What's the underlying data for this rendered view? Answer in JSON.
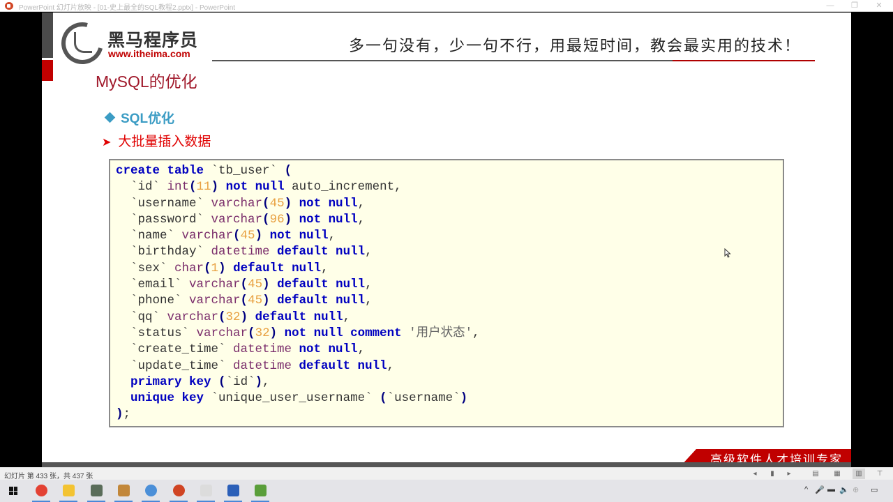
{
  "window": {
    "title": "PowerPoint 幻灯片放映 - [01-史上最全的SQL教程2.pptx] - PowerPoint",
    "minimize_label": "—",
    "restore_label": "❐",
    "close_label": "✕"
  },
  "slide": {
    "logo": {
      "brand_cn": "黑马程序员",
      "brand_url": "www.itheima.com"
    },
    "slogan": "多一句没有，少一句不行，用最短时间，教会最实用的技术！",
    "title": "MySQL的优化",
    "bullet_level1": "SQL优化",
    "bullet_level2": "大批量插入数据",
    "code_lines": [
      [
        {
          "t": "create table",
          "c": "kw"
        },
        {
          "t": " `tb_user` ",
          "c": ""
        },
        {
          "t": "(",
          "c": "pn"
        }
      ],
      [
        {
          "t": "  `id` ",
          "c": ""
        },
        {
          "t": "int",
          "c": "ty"
        },
        {
          "t": "(",
          "c": "pn"
        },
        {
          "t": "11",
          "c": "num"
        },
        {
          "t": ")",
          "c": "pn"
        },
        {
          "t": " not null",
          "c": "kw"
        },
        {
          "t": " auto_increment,",
          "c": ""
        }
      ],
      [
        {
          "t": "  `username` ",
          "c": ""
        },
        {
          "t": "varchar",
          "c": "ty"
        },
        {
          "t": "(",
          "c": "pn"
        },
        {
          "t": "45",
          "c": "num"
        },
        {
          "t": ")",
          "c": "pn"
        },
        {
          "t": " not null",
          "c": "kw"
        },
        {
          "t": ",",
          "c": ""
        }
      ],
      [
        {
          "t": "  `password` ",
          "c": ""
        },
        {
          "t": "varchar",
          "c": "ty"
        },
        {
          "t": "(",
          "c": "pn"
        },
        {
          "t": "96",
          "c": "num"
        },
        {
          "t": ")",
          "c": "pn"
        },
        {
          "t": " not null",
          "c": "kw"
        },
        {
          "t": ",",
          "c": ""
        }
      ],
      [
        {
          "t": "  `name` ",
          "c": ""
        },
        {
          "t": "varchar",
          "c": "ty"
        },
        {
          "t": "(",
          "c": "pn"
        },
        {
          "t": "45",
          "c": "num"
        },
        {
          "t": ")",
          "c": "pn"
        },
        {
          "t": " not null",
          "c": "kw"
        },
        {
          "t": ",",
          "c": ""
        }
      ],
      [
        {
          "t": "  `birthday` ",
          "c": ""
        },
        {
          "t": "datetime",
          "c": "ty"
        },
        {
          "t": " default null",
          "c": "kw"
        },
        {
          "t": ",",
          "c": ""
        }
      ],
      [
        {
          "t": "  `sex` ",
          "c": ""
        },
        {
          "t": "char",
          "c": "ty"
        },
        {
          "t": "(",
          "c": "pn"
        },
        {
          "t": "1",
          "c": "num"
        },
        {
          "t": ")",
          "c": "pn"
        },
        {
          "t": " default null",
          "c": "kw"
        },
        {
          "t": ",",
          "c": ""
        }
      ],
      [
        {
          "t": "  `email` ",
          "c": ""
        },
        {
          "t": "varchar",
          "c": "ty"
        },
        {
          "t": "(",
          "c": "pn"
        },
        {
          "t": "45",
          "c": "num"
        },
        {
          "t": ")",
          "c": "pn"
        },
        {
          "t": " default null",
          "c": "kw"
        },
        {
          "t": ",",
          "c": ""
        }
      ],
      [
        {
          "t": "  `phone` ",
          "c": ""
        },
        {
          "t": "varchar",
          "c": "ty"
        },
        {
          "t": "(",
          "c": "pn"
        },
        {
          "t": "45",
          "c": "num"
        },
        {
          "t": ")",
          "c": "pn"
        },
        {
          "t": " default null",
          "c": "kw"
        },
        {
          "t": ",",
          "c": ""
        }
      ],
      [
        {
          "t": "  `qq` ",
          "c": ""
        },
        {
          "t": "varchar",
          "c": "ty"
        },
        {
          "t": "(",
          "c": "pn"
        },
        {
          "t": "32",
          "c": "num"
        },
        {
          "t": ")",
          "c": "pn"
        },
        {
          "t": " default null",
          "c": "kw"
        },
        {
          "t": ",",
          "c": ""
        }
      ],
      [
        {
          "t": "  `status` ",
          "c": ""
        },
        {
          "t": "varchar",
          "c": "ty"
        },
        {
          "t": "(",
          "c": "pn"
        },
        {
          "t": "32",
          "c": "num"
        },
        {
          "t": ")",
          "c": "pn"
        },
        {
          "t": " not null comment",
          "c": "kw"
        },
        {
          "t": " '用户状态'",
          "c": "str"
        },
        {
          "t": ",",
          "c": ""
        }
      ],
      [
        {
          "t": "  `create_time` ",
          "c": ""
        },
        {
          "t": "datetime",
          "c": "ty"
        },
        {
          "t": " not null",
          "c": "kw"
        },
        {
          "t": ",",
          "c": ""
        }
      ],
      [
        {
          "t": "  `update_time` ",
          "c": ""
        },
        {
          "t": "datetime",
          "c": "ty"
        },
        {
          "t": " default null",
          "c": "kw"
        },
        {
          "t": ",",
          "c": ""
        }
      ],
      [
        {
          "t": "  primary key",
          "c": "kw"
        },
        {
          "t": " ",
          "c": ""
        },
        {
          "t": "(",
          "c": "pn"
        },
        {
          "t": "`id`",
          "c": ""
        },
        {
          "t": ")",
          "c": "pn"
        },
        {
          "t": ",",
          "c": ""
        }
      ],
      [
        {
          "t": "  unique key",
          "c": "kw"
        },
        {
          "t": " `unique_user_username` ",
          "c": ""
        },
        {
          "t": "(",
          "c": "pn"
        },
        {
          "t": "`username`",
          "c": ""
        },
        {
          "t": ")",
          "c": "pn"
        }
      ],
      [
        {
          "t": ")",
          "c": "pn"
        },
        {
          "t": ";",
          "c": ""
        }
      ]
    ],
    "footer_banner": "高级软件人才培训专家"
  },
  "statusbar": {
    "slide_count": "幻灯片 第 433 张，共 437 张",
    "buttons": [
      {
        "name": "previous-slide-button",
        "icon": "◂"
      },
      {
        "name": "slide-menu-button",
        "icon": "▮"
      },
      {
        "name": "next-slide-button",
        "icon": "▸"
      },
      {
        "name": "normal-view-button",
        "icon": "▤"
      },
      {
        "name": "slide-sorter-button",
        "icon": "▦"
      },
      {
        "name": "reading-view-button",
        "icon": "▥",
        "active": true
      },
      {
        "name": "slideshow-view-button",
        "icon": "⊤"
      }
    ]
  },
  "taskbar": {
    "apps": [
      {
        "name": "chrome",
        "color": "#e34133"
      },
      {
        "name": "file-explorer",
        "color": "#f3c332"
      },
      {
        "name": "image-viewer",
        "color": "#5a6d5a"
      },
      {
        "name": "paint-tool",
        "color": "#c2873a"
      },
      {
        "name": "browser-app",
        "color": "#4b8fd8"
      },
      {
        "name": "powerpoint",
        "color": "#d04423"
      },
      {
        "name": "text-editor",
        "color": "#dcdcdc"
      },
      {
        "name": "word",
        "color": "#2b5fb8"
      },
      {
        "name": "notepad-edit",
        "color": "#5a9e3a"
      }
    ],
    "tray": {
      "chevron": "^",
      "mic": "🎤",
      "battery": "▬",
      "volume": "🔈",
      "network": "⊕",
      "notifications": "▭"
    }
  }
}
